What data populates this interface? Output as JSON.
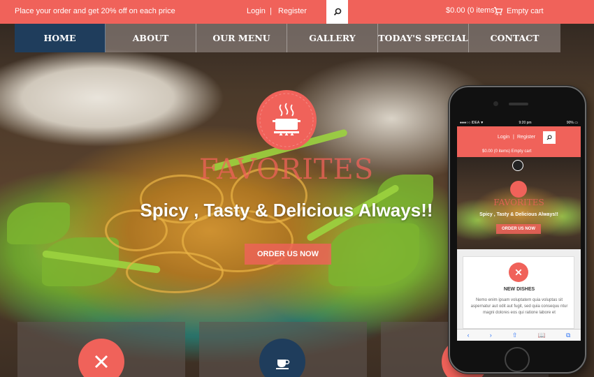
{
  "topbar": {
    "promo": "Place your order and get 20% off on each price",
    "login": "Login",
    "separator": "|",
    "register": "Register",
    "cart_amount": "$0.00 (0 items)",
    "cart_label": "Empty cart",
    "icons": {
      "search": "search-icon",
      "cart": "cart-icon"
    }
  },
  "nav": {
    "items": [
      {
        "label": "HOME",
        "active": true
      },
      {
        "label": "ABOUT"
      },
      {
        "label": "OUR MENU"
      },
      {
        "label": "GALLERY"
      },
      {
        "label": "TODAY'S SPECIAL"
      },
      {
        "label": "CONTACT"
      }
    ]
  },
  "hero": {
    "title": "FAVORITES",
    "subtitle": "Spicy , Tasty & Delicious Always!!",
    "button": "ORDER US NOW",
    "badge_icon": "cooking-pot-icon"
  },
  "features": {
    "icons": [
      "fork-knife-icon",
      "coffee-cup-icon",
      "feature-icon"
    ],
    "colors": [
      "#f0625a",
      "#1f3d5c",
      "#f0625a"
    ]
  },
  "mobile": {
    "status": {
      "carrier": "●●●○○ IDEA ▼",
      "time": "9:20 pm",
      "battery": "90% ▭"
    },
    "login": "Login",
    "separator": "|",
    "register": "Register",
    "cart": "$0.00 (0 items)  Empty cart",
    "hero_title": "FAVORITES",
    "hero_subtitle": "Spicy , Tasty & Delicious Always!!",
    "hero_button": "ORDER US NOW",
    "card_title": "NEW DISHES",
    "card_text": "Nemo enim ipsam voluptatem quia voluptas sit aspernatur aut odit aut fugit, sed quia consequu ntur magni dolores eos qui ratione labore et",
    "toolbar": [
      "‹",
      "›",
      "⇧",
      "📖",
      "⧉"
    ]
  },
  "colors": {
    "accent": "#f0625a",
    "nav_active": "#1f3d5c"
  }
}
